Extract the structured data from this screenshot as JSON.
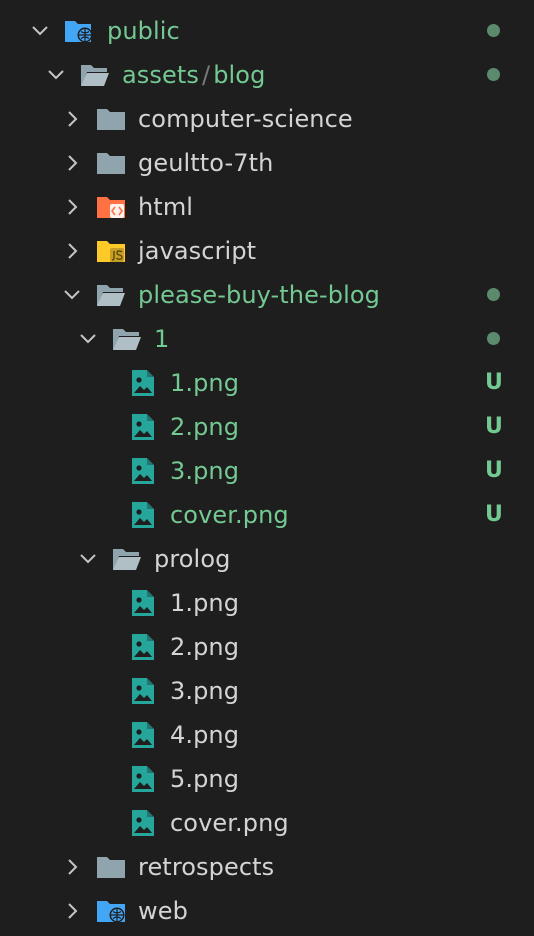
{
  "colors": {
    "background": "#1e1e1f",
    "folder": "#90a4ae",
    "folder_public": "#42a5f5",
    "html_folder": "#ff7043",
    "js_folder": "#ffca28",
    "image_icon": "#26a69a",
    "modified": "#73c991",
    "text": "#d4d4d4",
    "chevron": "#c5c5c5",
    "dot": "#5c8a6d"
  },
  "tree": {
    "public": {
      "label": "public",
      "icon": "folder-open-globe-icon",
      "expanded": true
    },
    "assets_blog": {
      "label_a": "assets",
      "separator": "/",
      "label_b": "blog",
      "icon": "folder-open-icon",
      "expanded": true
    },
    "computer_science": {
      "label": "computer-science",
      "icon": "folder-icon",
      "expanded": false
    },
    "geultto_7th": {
      "label": "geultto-7th",
      "icon": "folder-icon",
      "expanded": false
    },
    "html": {
      "label": "html",
      "icon": "html-folder-icon",
      "expanded": false
    },
    "javascript": {
      "label": "javascript",
      "icon": "js-folder-icon",
      "expanded": false
    },
    "please_buy": {
      "label": "please-buy-the-blog",
      "icon": "folder-open-icon",
      "expanded": true
    },
    "folder_1": {
      "label": "1",
      "icon": "folder-open-icon",
      "expanded": true
    },
    "f1_files": [
      {
        "label": "1.png",
        "badge": "U"
      },
      {
        "label": "2.png",
        "badge": "U"
      },
      {
        "label": "3.png",
        "badge": "U"
      },
      {
        "label": "cover.png",
        "badge": "U"
      }
    ],
    "prolog": {
      "label": "prolog",
      "icon": "folder-open-icon",
      "expanded": true
    },
    "prolog_files": [
      {
        "label": "1.png"
      },
      {
        "label": "2.png"
      },
      {
        "label": "3.png"
      },
      {
        "label": "4.png"
      },
      {
        "label": "5.png"
      },
      {
        "label": "cover.png"
      }
    ],
    "retrospects": {
      "label": "retrospects",
      "icon": "folder-icon",
      "expanded": false
    },
    "web": {
      "label": "web",
      "icon": "folder-globe-icon",
      "expanded": false
    }
  }
}
